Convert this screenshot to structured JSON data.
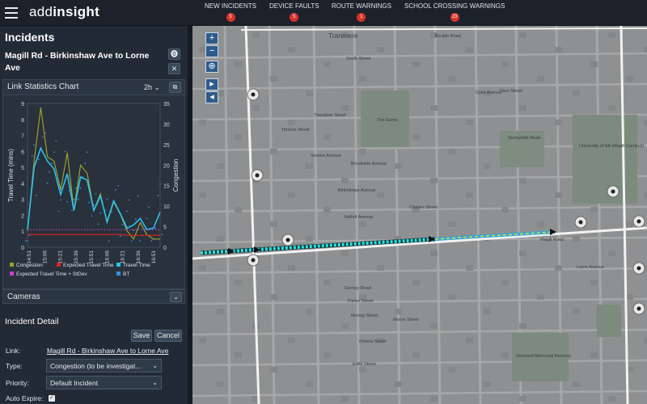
{
  "app": {
    "logo_prefix": "add",
    "logo_suffix": "insight"
  },
  "nav": [
    {
      "label": "NEW INCIDENTS",
      "count": "5"
    },
    {
      "label": "DEVICE FAULTS",
      "count": "5"
    },
    {
      "label": "ROUTE WARNINGS",
      "count": "1"
    },
    {
      "label": "SCHOOL CROSSING WARNINGS",
      "count": "23"
    }
  ],
  "sidebar": {
    "heading": "Incidents",
    "incident_title": "Magill Rd - Birkinshaw Ave to Lorne Ave",
    "chart_panel_label": "Link Statistics Chart",
    "range_value": "2h",
    "cameras_label": "Cameras",
    "detail_heading": "Incident Detail",
    "save_label": "Save",
    "cancel_label": "Cancel",
    "link_label": "Link:",
    "link_value": "Magill Rd - Birkinshaw Ave to Lorne Ave",
    "type_label": "Type:",
    "type_value": "Congestion (to be investigat...",
    "priority_label": "Priority:",
    "priority_value": "Default Incident",
    "auto_expire_label": "Auto Expire:"
  },
  "chart_data": {
    "type": "line",
    "xlabel": "",
    "ylabel": "Travel Time (mins)",
    "y2label": "Congestion",
    "categories": [
      "14:51",
      "15:06",
      "15:21",
      "15:36",
      "15:51",
      "16:06",
      "16:21",
      "16:36",
      "16:51"
    ],
    "ylim": [
      0,
      9
    ],
    "y2lim": [
      0,
      35
    ],
    "yticks": [
      "0",
      "1",
      "2",
      "3",
      "4",
      "5",
      "6",
      "7",
      "8",
      "9"
    ],
    "y2ticks": [
      "0",
      "5",
      "10",
      "15",
      "20",
      "25",
      "30",
      "35"
    ],
    "colors": {
      "congestion": "#9aa12a",
      "expected": "#e0221f",
      "travel": "#2cc0ef",
      "stdev": "#c542cf",
      "bt": "#3a8fd6"
    },
    "series": [
      {
        "name": "Congestion",
        "axis": "y2",
        "values": [
          4,
          21,
          34,
          22,
          21,
          14,
          23,
          9,
          20,
          18,
          9,
          13,
          6,
          11,
          8,
          4,
          2,
          6,
          3,
          2,
          2
        ]
      },
      {
        "name": "Expected Travel Time",
        "axis": "y",
        "values": [
          0.8,
          0.8,
          0.8,
          0.8,
          0.8,
          0.8,
          0.8,
          0.8,
          0.8,
          0.8,
          0.8,
          0.8,
          0.8,
          0.8,
          0.8,
          0.75,
          0.75,
          0.75,
          0.75,
          0.75,
          0.75
        ]
      },
      {
        "name": "Travel Time",
        "axis": "y",
        "values": [
          1.1,
          5,
          6.2,
          5.4,
          4.9,
          3.3,
          4.6,
          2.3,
          4.4,
          4.2,
          2.3,
          3.2,
          1.6,
          2.9,
          2.1,
          1.2,
          1.4,
          1.8,
          1.1,
          1.2,
          2.2
        ]
      },
      {
        "name": "Expected Travel Time + StDev",
        "axis": "y",
        "values": [
          1.1,
          1.1,
          1.1,
          1.1,
          1.1,
          1.1,
          1.1,
          1.1,
          1.1,
          1.1,
          1.1,
          1.1,
          1.1,
          1.1,
          1.1,
          1.1,
          1.1,
          1.1,
          1.1,
          1.1,
          1.1
        ]
      },
      {
        "name": "BT",
        "axis": "y",
        "values": []
      }
    ],
    "legend": [
      "Congestion",
      "Expected Travel Time",
      "Travel Time",
      "Expected Travel Time + StDev",
      "BT"
    ]
  },
  "map": {
    "labels": [
      "Tranmere",
      "Magill Road",
      "Beulah Road",
      "Dyke Avenue",
      "Torrens Street",
      "Theodore Street",
      "Swaine Avenue",
      "Glen Street",
      "Charles Street",
      "Birkinshaw Avenue",
      "The Gums",
      "Sunnyside Road",
      "Brookside Avenue",
      "Smith Street",
      "Hallett Avenue",
      "Gurney Road",
      "Fisher Street",
      "Murray Street",
      "Victoria Street",
      "Edith Street",
      "University of SA (Magill Campus)",
      "Lorne Avenue",
      "Moore Street",
      "Norwood Memorial Reserve"
    ]
  }
}
